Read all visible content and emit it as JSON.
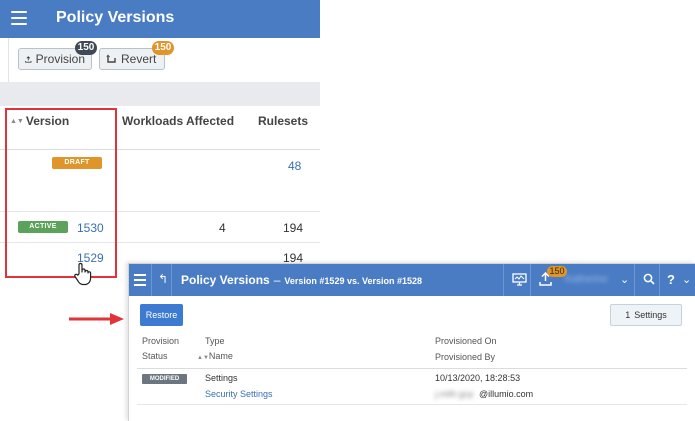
{
  "back_panel": {
    "header": {
      "title": "Policy Versions"
    },
    "toolbar": {
      "provision": {
        "label": "Provision",
        "badge": "150"
      },
      "revert": {
        "label": "Revert",
        "badge": "150"
      }
    },
    "table": {
      "columns": [
        "Version",
        "Workloads Affected",
        "Rulesets"
      ],
      "rows": [
        {
          "status": "DRAFT",
          "version": "",
          "workloads": "",
          "rulesets": "48"
        },
        {
          "status": "ACTIVE",
          "version": "1530",
          "workloads": "4",
          "rulesets": "194"
        },
        {
          "status": "",
          "version": "1529",
          "workloads": "",
          "rulesets": "194"
        }
      ]
    }
  },
  "front_panel": {
    "header": {
      "title": "Policy Versions",
      "dash": "–",
      "subtitle": "Version #1529 vs. Version #1528",
      "upload_badge": "150",
      "user_name": "Katherine",
      "help": "?"
    },
    "restore_label": "Restore",
    "settings": {
      "count": "1",
      "label": "Settings"
    },
    "columns": {
      "provision_status_1": "Provision",
      "provision_status_2": "Status",
      "type": "Type",
      "name": "Name",
      "provisioned_on": "Provisioned On",
      "provisioned_by": "Provisioned By"
    },
    "row": {
      "status": "MODIFIED",
      "type": "Settings",
      "name": "Security Settings",
      "provisioned_on": "10/13/2020, 18:28:53",
      "provisioned_by_hidden": "j.mith.guy",
      "provisioned_by_domain": "@illumio.com"
    }
  },
  "colors": {
    "topbar": "#4a7cc4",
    "draft": "#e0952a",
    "active": "#5ba35b",
    "modified": "#6c7580",
    "link": "#3a6fb5",
    "highlight": "#e0333a",
    "primary_button": "#3d7ad1"
  },
  "icons": {
    "menu": "hamburger-icon",
    "upload": "upload-icon",
    "revert": "revert-icon",
    "pointer": "hand-cursor-icon",
    "arrow": "red-arrow-icon",
    "monitor": "monitor-icon",
    "search": "search-icon",
    "back": "back-icon",
    "chevron": "chevron-down-icon"
  }
}
